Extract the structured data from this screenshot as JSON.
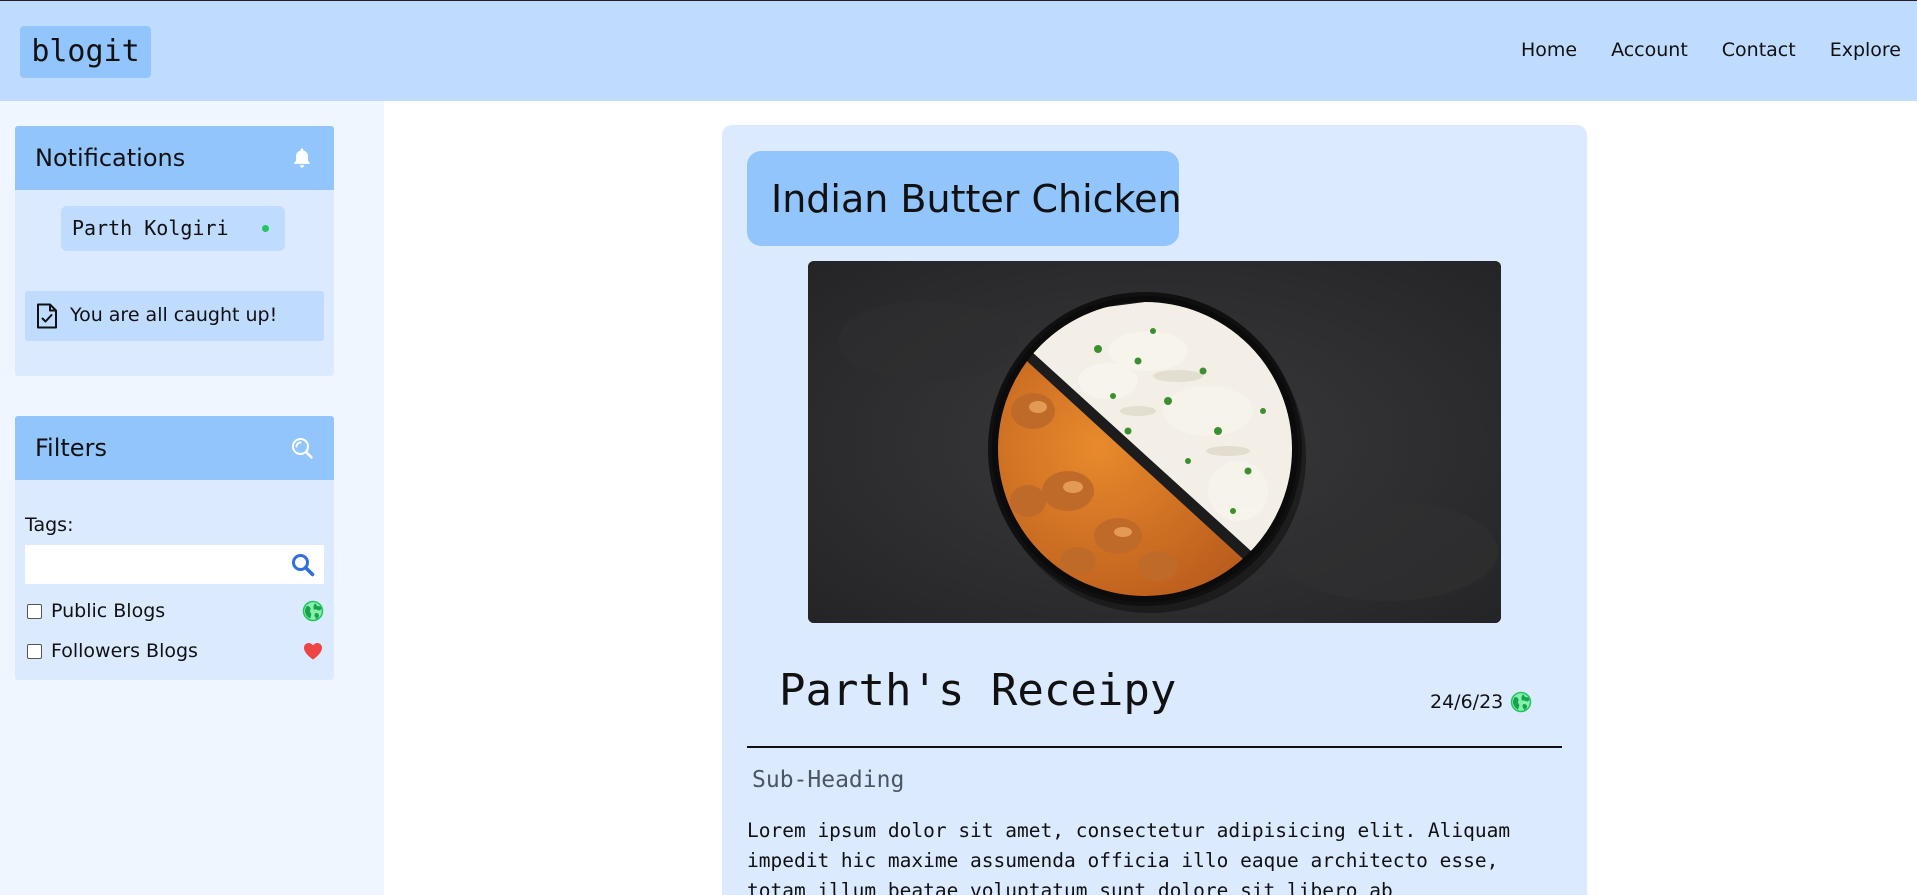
{
  "header": {
    "logo": "blogit",
    "nav": [
      "Home",
      "Account",
      "Contact",
      "Explore"
    ]
  },
  "notifications": {
    "title": "Notifications",
    "icon": "bell-icon",
    "user_name": "Parth Kolgiri",
    "status_color": "#22c55e",
    "caught_up_text": "You are all caught up!"
  },
  "filters": {
    "title": "Filters",
    "icon": "search-magnify-icon",
    "tags_label": "Tags:",
    "tags_value": "",
    "options": [
      {
        "label": "Public Blogs",
        "icon": "globe-icon",
        "checked": false
      },
      {
        "label": "Followers Blogs",
        "icon": "heart-icon",
        "checked": false
      }
    ]
  },
  "post": {
    "title": "Indian Butter Chicken",
    "heading": "Parth's Receipy",
    "date": "24/6/23",
    "visibility_icon": "globe-icon",
    "subheading": "Sub-Heading",
    "body": "Lorem ipsum dolor sit amet, consectetur adipisicing elit. Aliquam impedit hic maxime assumenda officia illo eaque architecto esse, totam illum beatae voluptatum sunt dolore sit libero ab"
  },
  "colors": {
    "header_bg": "#bfdbfe",
    "accent": "#93c5fd",
    "panel_bg": "#dbeafe",
    "sidebar_bg": "#eff6ff"
  }
}
